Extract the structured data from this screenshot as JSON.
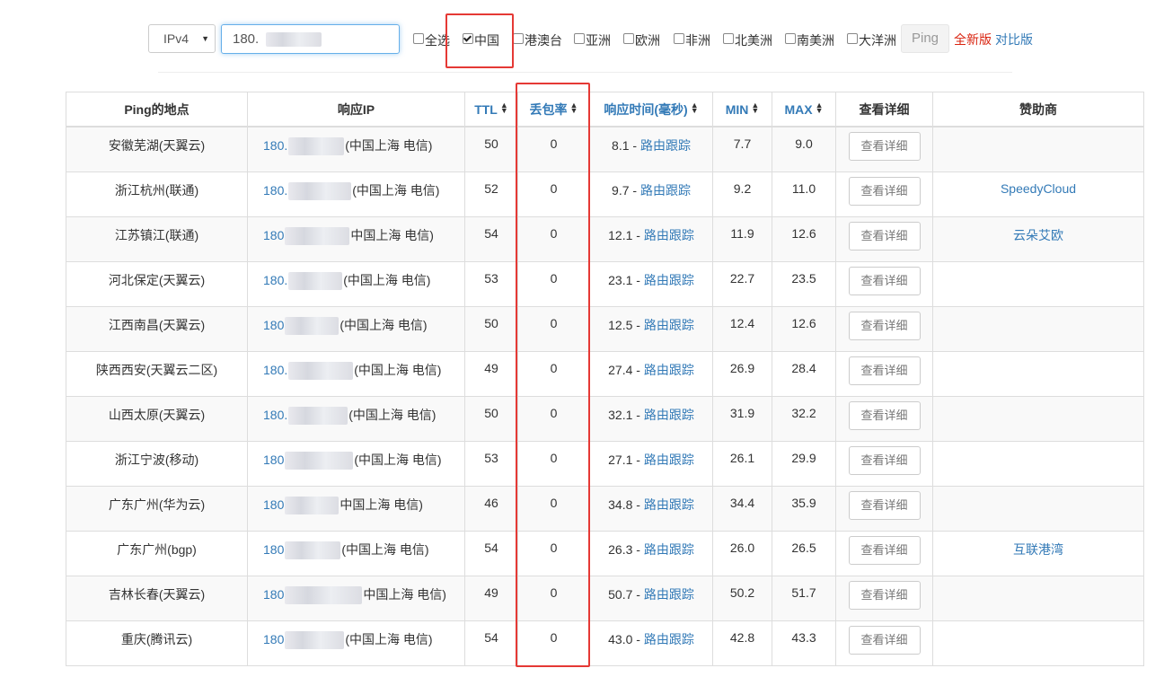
{
  "toolbar": {
    "ip_version": "IPv4",
    "ip_input_visible": "180.",
    "checkboxes": [
      {
        "label": "全选",
        "checked": false
      },
      {
        "label": "中国",
        "checked": true
      },
      {
        "label": "港澳台",
        "checked": false
      },
      {
        "label": "亚洲",
        "checked": false
      },
      {
        "label": "欧洲",
        "checked": false
      },
      {
        "label": "非洲",
        "checked": false
      },
      {
        "label": "北美洲",
        "checked": false
      },
      {
        "label": "南美洲",
        "checked": false
      },
      {
        "label": "大洋洲",
        "checked": false
      }
    ],
    "ping_label": "Ping",
    "new_version_label": "全新版",
    "compare_label": "对比版"
  },
  "colors": {
    "link": "#337ab7",
    "highlight": "#e53935",
    "new_version": "#d9230f"
  },
  "table": {
    "headers": [
      "Ping的地点",
      "响应IP",
      "TTL",
      "丢包率",
      "响应时间(毫秒)",
      "MIN",
      "MAX",
      "查看详细",
      "赞助商"
    ],
    "rows": [
      {
        "location": "安徽芜湖(天翼云)",
        "ip": "180.",
        "ip_loc": "(中国上海 电信)",
        "ttl": "50",
        "loss": "0",
        "time": "8.1",
        "trace": "路由跟踪",
        "min": "7.7",
        "max": "9.0",
        "detail": "查看详细",
        "sponsor": ""
      },
      {
        "location": "浙江杭州(联通)",
        "ip": "180.",
        "ip_loc": "(中国上海 电信)",
        "ttl": "52",
        "loss": "0",
        "time": "9.7",
        "trace": "路由跟踪",
        "min": "9.2",
        "max": "11.0",
        "detail": "查看详细",
        "sponsor": "SpeedyCloud"
      },
      {
        "location": "江苏镇江(联通)",
        "ip": "180",
        "ip_loc": "中国上海 电信)",
        "ttl": "54",
        "loss": "0",
        "time": "12.1",
        "trace": "路由跟踪",
        "min": "11.9",
        "max": "12.6",
        "detail": "查看详细",
        "sponsor": "云朵艾欧"
      },
      {
        "location": "河北保定(天翼云)",
        "ip": "180.",
        "ip_loc": "(中国上海 电信)",
        "ttl": "53",
        "loss": "0",
        "time": "23.1",
        "trace": "路由跟踪",
        "min": "22.7",
        "max": "23.5",
        "detail": "查看详细",
        "sponsor": ""
      },
      {
        "location": "江西南昌(天翼云)",
        "ip": "180",
        "ip_loc": "(中国上海 电信)",
        "ttl": "50",
        "loss": "0",
        "time": "12.5",
        "trace": "路由跟踪",
        "min": "12.4",
        "max": "12.6",
        "detail": "查看详细",
        "sponsor": ""
      },
      {
        "location": "陕西西安(天翼云二区)",
        "ip": "180.",
        "ip_loc": "(中国上海 电信)",
        "ttl": "49",
        "loss": "0",
        "time": "27.4",
        "trace": "路由跟踪",
        "min": "26.9",
        "max": "28.4",
        "detail": "查看详细",
        "sponsor": ""
      },
      {
        "location": "山西太原(天翼云)",
        "ip": "180.",
        "ip_loc": "(中国上海 电信)",
        "ttl": "50",
        "loss": "0",
        "time": "32.1",
        "trace": "路由跟踪",
        "min": "31.9",
        "max": "32.2",
        "detail": "查看详细",
        "sponsor": ""
      },
      {
        "location": "浙江宁波(移动)",
        "ip": "180",
        "ip_loc": "(中国上海 电信)",
        "ttl": "53",
        "loss": "0",
        "time": "27.1",
        "trace": "路由跟踪",
        "min": "26.1",
        "max": "29.9",
        "detail": "查看详细",
        "sponsor": ""
      },
      {
        "location": "广东广州(华为云)",
        "ip": "180",
        "ip_loc": "中国上海 电信)",
        "ttl": "46",
        "loss": "0",
        "time": "34.8",
        "trace": "路由跟踪",
        "min": "34.4",
        "max": "35.9",
        "detail": "查看详细",
        "sponsor": ""
      },
      {
        "location": "广东广州(bgp)",
        "ip": "180",
        "ip_loc": "(中国上海 电信)",
        "ttl": "54",
        "loss": "0",
        "time": "26.3",
        "trace": "路由跟踪",
        "min": "26.0",
        "max": "26.5",
        "detail": "查看详细",
        "sponsor": "互联港湾"
      },
      {
        "location": "吉林长春(天翼云)",
        "ip": "180",
        "ip_loc": "中国上海 电信)",
        "ttl": "49",
        "loss": "0",
        "time": "50.7",
        "trace": "路由跟踪",
        "min": "50.2",
        "max": "51.7",
        "detail": "查看详细",
        "sponsor": ""
      },
      {
        "location": "重庆(腾讯云)",
        "ip": "180",
        "ip_loc": "(中国上海 电信)",
        "ttl": "54",
        "loss": "0",
        "time": "43.0",
        "trace": "路由跟踪",
        "min": "42.8",
        "max": "43.3",
        "detail": "查看详细",
        "sponsor": ""
      }
    ]
  }
}
